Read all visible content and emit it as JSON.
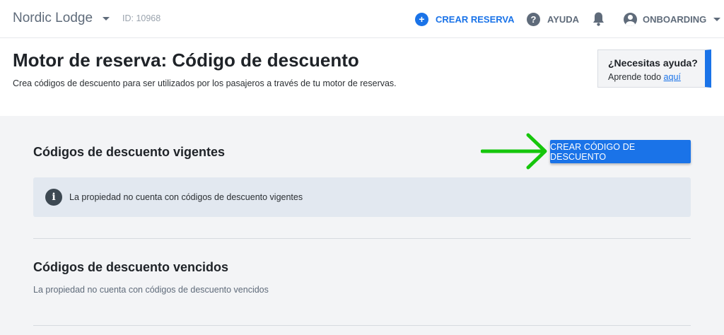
{
  "topbar": {
    "property_name": "Nordic Lodge",
    "property_id": "ID: 10968",
    "create_reservation": "CREAR RESERVA",
    "help": "AYUDA",
    "account": "ONBOARDING"
  },
  "header": {
    "title": "Motor de reserva: Código de descuento",
    "subtitle": "Crea códigos de descuento para ser utilizados por los pasajeros a través de tu motor de reservas."
  },
  "help_card": {
    "title": "¿Necesitas ayuda?",
    "text": "Aprende todo ",
    "link": "aquí"
  },
  "active_section": {
    "title": "Códigos de descuento vigentes",
    "create_button": "CREAR CÓDIGO DE DESCUENTO",
    "info_message": "La propiedad no cuenta con códigos de descuento vigentes"
  },
  "expired_section": {
    "title": "Códigos de descuento vencidos",
    "message": "La propiedad no cuenta con códigos de descuento vencidos"
  },
  "icons": {
    "plus": "plus-circle-icon",
    "help": "question-circle-icon",
    "bell": "bell-icon",
    "user": "account-circle-icon",
    "info": "info-icon",
    "arrow": "green-arrow-icon"
  },
  "colors": {
    "accent": "#1a73e8",
    "arrow": "#16c60c",
    "content_bg": "#f3f4f6",
    "info_bg": "#e2e8f0"
  }
}
